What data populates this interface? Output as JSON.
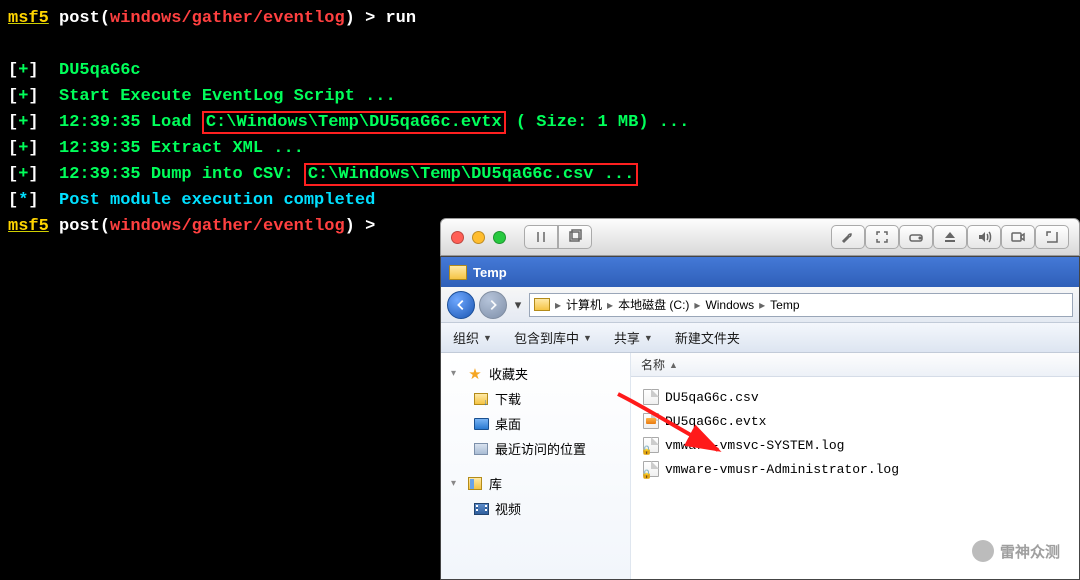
{
  "terminal": {
    "prompt_msf": "msf5",
    "prompt_post": " post(",
    "prompt_module": "windows/gather/eventlog",
    "prompt_close": ") > ",
    "cmd_run": "run",
    "l1_tag": "[+]",
    "l1_txt": "  DU5qaG6c",
    "l2_tag": "[+]",
    "l2_txt": "  Start Execute EventLog Script ...",
    "l3_tag": "[+]",
    "l3_a": "  12:39:35 Load ",
    "l3_hl": "C:\\Windows\\Temp\\DU5qaG6c.evtx",
    "l3_b": " ( Size: 1 MB) ...",
    "l4_tag": "[+]",
    "l4_txt": "  12:39:35 Extract XML ...",
    "l5_tag": "[+]",
    "l5_a": "  12:39:35 Dump into CSV: ",
    "l5_hl": "C:\\Windows\\Temp\\DU5qaG6c.csv ...",
    "l6_tag": "[*]",
    "l6_txt": "  Post module execution completed"
  },
  "mac": {
    "pause": "⏸",
    "copy": "❐"
  },
  "explorer": {
    "title": "Temp",
    "path_computer": "计算机",
    "path_drive": "本地磁盘 (C:)",
    "path_windows": "Windows",
    "path_temp": "Temp",
    "path_sep": "▸",
    "tb_org": "组织",
    "tb_include": "包含到库中",
    "tb_share": "共享",
    "tb_new": "新建文件夹",
    "side_fav": "收藏夹",
    "side_downloads": "下载",
    "side_desktop": "桌面",
    "side_recent": "最近访问的位置",
    "side_libs": "库",
    "side_video": "视频",
    "col_name": "名称",
    "files": [
      "DU5qaG6c.csv",
      "DU5qaG6c.evtx",
      "vmware-vmsvc-SYSTEM.log",
      "vmware-vmusr-Administrator.log"
    ]
  },
  "watermark": "雷神众测"
}
